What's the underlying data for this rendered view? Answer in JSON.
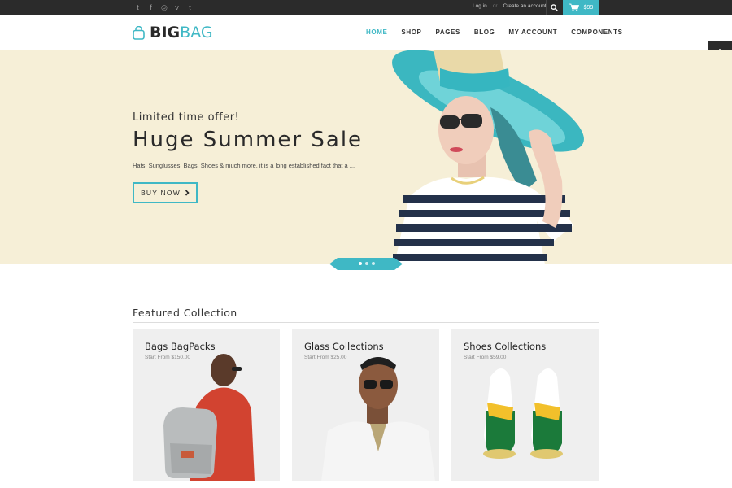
{
  "topbar": {
    "social": [
      "twitter-icon",
      "facebook-icon",
      "dribbble-icon",
      "vimeo-icon",
      "tumblr-icon"
    ],
    "login_label": "Log in",
    "or_label": "or",
    "create_account_label": "Create an account",
    "cart_total": "$99"
  },
  "header": {
    "logo_big": "BIG",
    "logo_bag": "BAG",
    "nav": [
      "HOME",
      "SHOP",
      "PAGES",
      "BLOG",
      "MY ACCOUNT",
      "COMPONENTS"
    ],
    "active_nav": "HOME"
  },
  "hero": {
    "eyebrow": "Limited time offer!",
    "title": "Huge Summer Sale",
    "description": "Hats, Sunglusses, Bags, Shoes & much more, it is a long established fact that a ...",
    "button_label": "BUY NOW",
    "slide_count": 3,
    "active_slide": 1
  },
  "featured": {
    "title": "Featured Collection",
    "cards": [
      {
        "title": "Bags BagPacks",
        "subtitle": "Start From $150.00"
      },
      {
        "title": "Glass Collections",
        "subtitle": "Start From $25.00"
      },
      {
        "title": "Shoes Collections",
        "subtitle": "Start From $59.00"
      }
    ]
  },
  "colors": {
    "accent": "#3fb8c5",
    "topbar": "#2b2b2b",
    "hero_bg": "#f6efd7",
    "card_bg": "#efefef"
  }
}
